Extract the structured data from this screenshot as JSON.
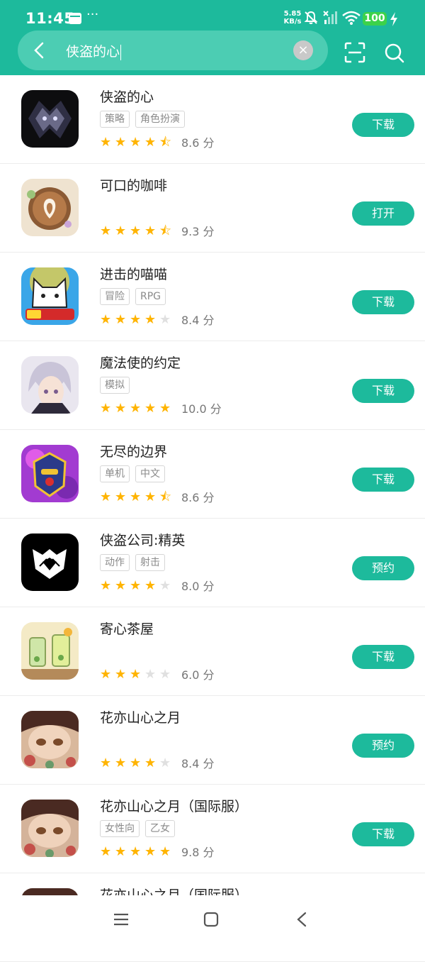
{
  "status_bar": {
    "time": "11:45",
    "more_indicator": "···",
    "net_speed_value": "5.85",
    "net_speed_unit": "KB/s",
    "battery": "100",
    "battery_color": "#3cd24a"
  },
  "search": {
    "query": "侠盗的心",
    "accent_color": "#1dba9c"
  },
  "apps": [
    {
      "name": "侠盗的心",
      "tags": [
        "策略",
        "角色扮演"
      ],
      "rating": 4.5,
      "score_text": "8.6 分",
      "action": "下载"
    },
    {
      "name": "可口的咖啡",
      "tags": [],
      "rating": 4.5,
      "score_text": "9.3 分",
      "action": "打开"
    },
    {
      "name": "进击的喵喵",
      "tags": [
        "冒险",
        "RPG"
      ],
      "rating": 4,
      "score_text": "8.4 分",
      "action": "下载"
    },
    {
      "name": "魔法使的约定",
      "tags": [
        "模拟"
      ],
      "rating": 5,
      "score_text": "10.0 分",
      "action": "下载"
    },
    {
      "name": "无尽的边界",
      "tags": [
        "单机",
        "中文"
      ],
      "rating": 4.5,
      "score_text": "8.6 分",
      "action": "下载"
    },
    {
      "name": "侠盗公司:精英",
      "tags": [
        "动作",
        "射击"
      ],
      "rating": 4,
      "score_text": "8.0 分",
      "action": "预约"
    },
    {
      "name": "寄心茶屋",
      "tags": [],
      "rating": 3,
      "score_text": "6.0 分",
      "action": "下载"
    },
    {
      "name": "花亦山心之月",
      "tags": [],
      "rating": 4,
      "score_text": "8.4 分",
      "action": "预约"
    },
    {
      "name": "花亦山心之月（国际服）",
      "tags": [
        "女性向",
        "乙女"
      ],
      "rating": 5,
      "score_text": "9.8 分",
      "action": "下载"
    },
    {
      "name": "花亦山心之月（国际服）",
      "tags": [],
      "rating": 0,
      "score_text": "",
      "action": ""
    }
  ]
}
